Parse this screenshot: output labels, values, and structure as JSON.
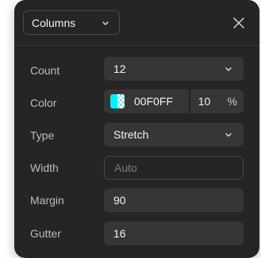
{
  "header": {
    "layout_type": "Columns"
  },
  "rows": {
    "count": {
      "label": "Count",
      "value": "12"
    },
    "color": {
      "label": "Color",
      "hex": "00F0FF",
      "opacity": "10",
      "unit": "%",
      "swatch_color": "#00F0FF"
    },
    "type": {
      "label": "Type",
      "value": "Stretch"
    },
    "width": {
      "label": "Width",
      "placeholder": "Auto"
    },
    "margin": {
      "label": "Margin",
      "value": "90"
    },
    "gutter": {
      "label": "Gutter",
      "value": "16"
    }
  },
  "icons": {
    "header_chevron": "chevron-down-icon",
    "close": "close-icon"
  },
  "colors": {
    "panel_bg": "#252525",
    "field_bg": "#363636"
  }
}
